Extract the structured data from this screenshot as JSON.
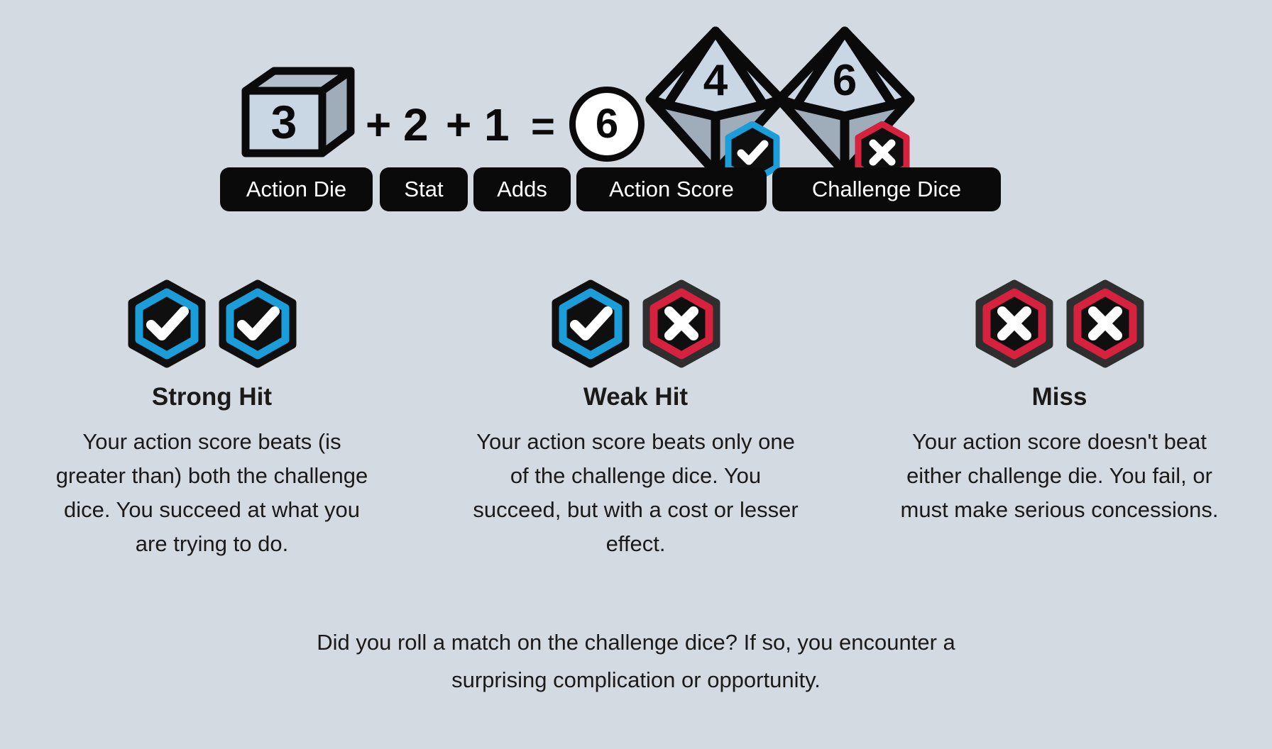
{
  "background_color": "#d4dae1",
  "colors": {
    "ink": "#0a0a0a",
    "hit_blue": "#1b9dd9",
    "miss_red": "#d6213f",
    "die_face_light": "#c9d6e4",
    "die_face_mid": "#9fadba",
    "text": "#1a1a1a",
    "white": "#ffffff"
  },
  "formula": {
    "action_die_value": "3",
    "plus_1": "+",
    "stat_value": "2",
    "plus_2": "+",
    "adds_value": "1",
    "equals": "=",
    "action_score_value": "6",
    "challenge_die_1_value": "4",
    "challenge_die_2_value": "6",
    "challenge_die_1_badge": "check",
    "challenge_die_2_badge": "cross",
    "labels": {
      "action_die": "Action Die",
      "stat": "Stat",
      "adds": "Adds",
      "action_score": "Action Score",
      "challenge_dice": "Challenge Dice"
    }
  },
  "outcomes": [
    {
      "id": "strong-hit",
      "title": "Strong Hit",
      "badges": [
        "check",
        "check"
      ],
      "description": "Your action score beats (is greater than) both the challenge dice. You succeed at what you are trying to do."
    },
    {
      "id": "weak-hit",
      "title": "Weak Hit",
      "badges": [
        "check",
        "cross"
      ],
      "description": "Your action score beats only one of the challenge dice. You succeed, but with a cost or lesser effect."
    },
    {
      "id": "miss",
      "title": "Miss",
      "badges": [
        "cross",
        "cross"
      ],
      "description": "Your action score doesn't beat either challenge die. You fail, or must make serious concessions."
    }
  ],
  "footer": {
    "line_1": "Did you roll a match on the challenge dice? If so, you encounter a",
    "line_2": "surprising complication or opportunity."
  },
  "icons": {
    "check": "check-icon",
    "cross": "cross-icon",
    "cube": "cube-die-icon",
    "d10": "d10-die-icon"
  }
}
